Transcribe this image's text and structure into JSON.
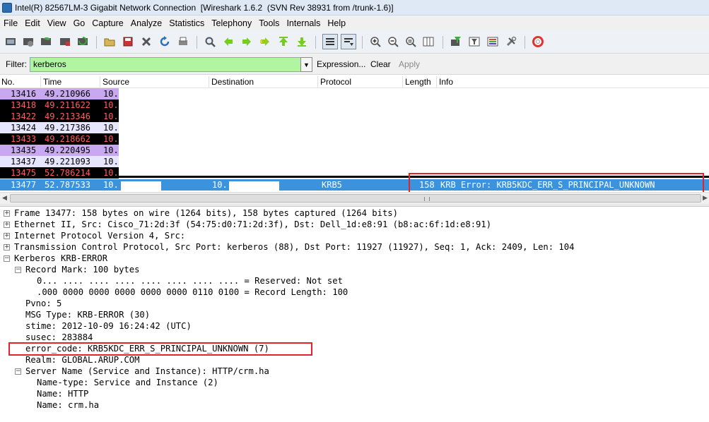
{
  "window": {
    "title": "Intel(R) 82567LM-3 Gigabit Network Connection  [Wireshark 1.6.2  (SVN Rev 38931 from /trunk-1.6)]"
  },
  "menu": [
    "File",
    "Edit",
    "View",
    "Go",
    "Capture",
    "Analyze",
    "Statistics",
    "Telephony",
    "Tools",
    "Internals",
    "Help"
  ],
  "toolbar": {
    "icons": [
      "interfaces-icon",
      "options-icon",
      "start-capture-icon",
      "stop-capture-icon",
      "restart-capture-icon",
      "open-file-icon",
      "save-file-icon",
      "close-file-icon",
      "reload-icon",
      "print-icon",
      "find-packet-icon",
      "go-back-icon",
      "go-forward-icon",
      "go-to-packet-icon",
      "go-first-icon",
      "go-last-icon",
      "colorize-icon",
      "autoscroll-icon",
      "zoom-in-icon",
      "zoom-out-icon",
      "zoom-normal-icon",
      "resize-columns-icon",
      "capture-filters-icon",
      "display-filters-icon",
      "coloring-rules-icon",
      "preferences-icon",
      "help-icon"
    ]
  },
  "filter": {
    "label": "Filter:",
    "value": "kerberos",
    "expression_label": "Expression...",
    "clear_label": "Clear",
    "apply_label": "Apply",
    "bg_color": "#b1f5a3"
  },
  "columns": [
    "No.",
    "Time",
    "Source",
    "Destination",
    "Protocol",
    "Length",
    "Info"
  ],
  "packets": [
    {
      "no": "13416",
      "time": "49.210966",
      "src": "10.",
      "bg": "#c8a8f0",
      "fg": "#000000"
    },
    {
      "no": "13418",
      "time": "49.211622",
      "src": "10.",
      "bg": "#000000",
      "fg": "#ff5f5f"
    },
    {
      "no": "13422",
      "time": "49.213346",
      "src": "10.",
      "bg": "#000000",
      "fg": "#ff5f5f"
    },
    {
      "no": "13424",
      "time": "49.217386",
      "src": "10.",
      "bg": "#e7e6ff",
      "fg": "#000000"
    },
    {
      "no": "13433",
      "time": "49.218662",
      "src": "10.",
      "bg": "#000000",
      "fg": "#ff5f5f"
    },
    {
      "no": "13435",
      "time": "49.220495",
      "src": "10.",
      "bg": "#c8a8f0",
      "fg": "#000000"
    },
    {
      "no": "13437",
      "time": "49.221093",
      "src": "10.",
      "bg": "#e7e6ff",
      "fg": "#000000"
    },
    {
      "no": "13475",
      "time": "52.786214",
      "src": "10.",
      "bg": "#000000",
      "fg": "#ff5f5f"
    }
  ],
  "selected_packet": {
    "no": "13477",
    "time": "52.787533",
    "src": "10.",
    "dst": "10.",
    "protocol": "KRB5",
    "length": "158",
    "info": "KRB Error: KRB5KDC_ERR_S_PRINCIPAL_UNKNOWN",
    "bg": "#3a93dc"
  },
  "details": [
    {
      "text": "Frame 13477: 158 bytes on wire (1264 bits), 158 bytes captured (1264 bits)",
      "toggle": "+"
    },
    {
      "text": "Ethernet II, Src: Cisco_71:2d:3f (54:75:d0:71:2d:3f), Dst: Dell_1d:e8:91 (b8:ac:6f:1d:e8:91)",
      "toggle": "+"
    },
    {
      "text": "Internet Protocol Version 4, Src:",
      "toggle": "+"
    },
    {
      "text": "Transmission Control Protocol, Src Port: kerberos (88), Dst Port: 11927 (11927), Seq: 1, Ack: 2409, Len: 104",
      "toggle": "+"
    },
    {
      "text": "Kerberos KRB-ERROR",
      "toggle": "-"
    },
    {
      "text": "Record Mark: 100 bytes",
      "toggle": "-"
    },
    {
      "text": "0... .... .... .... .... .... .... .... = Reserved: Not set",
      "toggle": ""
    },
    {
      "text": ".000 0000 0000 0000 0000 0000 0110 0100 = Record Length: 100",
      "toggle": ""
    },
    {
      "text": "Pvno: 5",
      "toggle": ""
    },
    {
      "text": "MSG Type: KRB-ERROR (30)",
      "toggle": ""
    },
    {
      "text": "stime: 2012-10-09 16:24:42 (UTC)",
      "toggle": ""
    },
    {
      "text": "susec: 283884",
      "toggle": ""
    },
    {
      "text": "error_code: KRB5KDC_ERR_S_PRINCIPAL_UNKNOWN (7)",
      "toggle": ""
    },
    {
      "text": "Realm: GLOBAL.ARUP.COM",
      "toggle": ""
    },
    {
      "text": "Server Name (Service and Instance): HTTP/crm.ha",
      "toggle": "-"
    },
    {
      "text": "Name-type: Service and Instance (2)",
      "toggle": ""
    },
    {
      "text": "Name: HTTP",
      "toggle": ""
    },
    {
      "text": "Name: crm.ha",
      "toggle": ""
    }
  ],
  "annotation_color": "#e0242a"
}
